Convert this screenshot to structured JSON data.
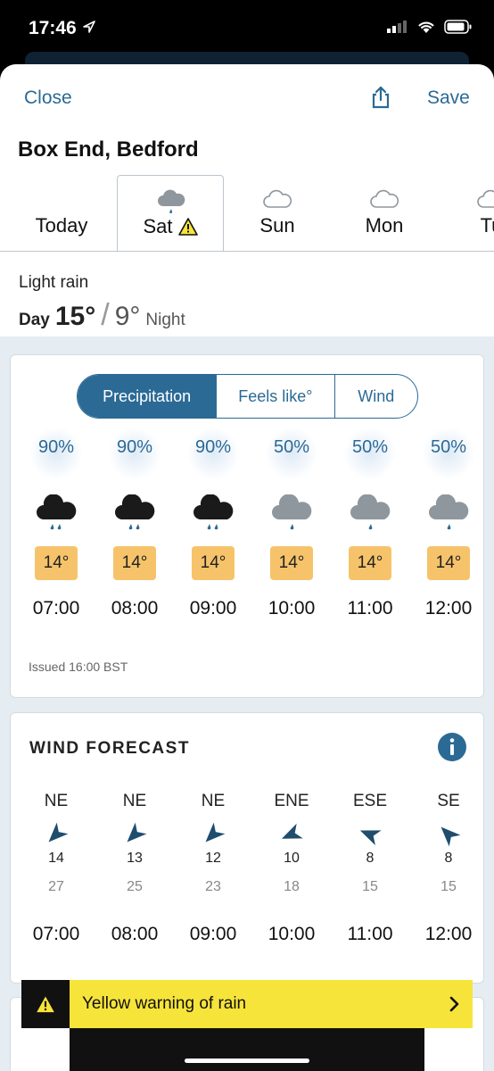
{
  "status": {
    "time": "17:46"
  },
  "header": {
    "close_label": "Close",
    "save_label": "Save",
    "location": "Box End, Bedford"
  },
  "tabs": [
    {
      "label": "Today",
      "icon": "none",
      "active": false
    },
    {
      "label": "Sat",
      "icon": "rain-cloud-icon",
      "warning": true,
      "active": true
    },
    {
      "label": "Sun",
      "icon": "cloud-icon",
      "active": false
    },
    {
      "label": "Mon",
      "icon": "cloud-icon",
      "active": false
    },
    {
      "label": "Tu",
      "icon": "cloud-icon",
      "active": false
    }
  ],
  "summary": {
    "condition": "Light rain",
    "day_label": "Day",
    "day_temp": "15°",
    "night_temp": "9°",
    "night_label": "Night"
  },
  "hourly": {
    "segments": [
      {
        "label": "Precipitation",
        "active": true
      },
      {
        "label": "Feels like°",
        "active": false
      },
      {
        "label": "Wind",
        "active": false
      }
    ],
    "hours": [
      {
        "pct": "90%",
        "icon": "heavy-rain-cloud-icon",
        "temp": "14°",
        "time": "07:00"
      },
      {
        "pct": "90%",
        "icon": "heavy-rain-cloud-icon",
        "temp": "14°",
        "time": "08:00"
      },
      {
        "pct": "90%",
        "icon": "heavy-rain-cloud-icon",
        "temp": "14°",
        "time": "09:00"
      },
      {
        "pct": "50%",
        "icon": "light-rain-cloud-icon",
        "temp": "14°",
        "time": "10:00"
      },
      {
        "pct": "50%",
        "icon": "light-rain-cloud-icon",
        "temp": "14°",
        "time": "11:00"
      },
      {
        "pct": "50%",
        "icon": "light-rain-cloud-icon",
        "temp": "14°",
        "time": "12:00"
      }
    ],
    "issued": "Issued 16:00 BST"
  },
  "wind": {
    "title": "WIND FORECAST",
    "cols": [
      {
        "dir": "NE",
        "speed": "14",
        "gust": "27",
        "time": "07:00"
      },
      {
        "dir": "NE",
        "speed": "13",
        "gust": "25",
        "time": "08:00"
      },
      {
        "dir": "NE",
        "speed": "12",
        "gust": "23",
        "time": "09:00"
      },
      {
        "dir": "ENE",
        "speed": "10",
        "gust": "18",
        "time": "10:00"
      },
      {
        "dir": "ESE",
        "speed": "8",
        "gust": "15",
        "time": "11:00"
      },
      {
        "dir": "SE",
        "speed": "8",
        "gust": "15",
        "time": "12:00"
      }
    ]
  },
  "warning": {
    "text": "Yellow warning of rain"
  },
  "colors": {
    "accent": "#2b6a95",
    "temp_badge": "#f6c36b",
    "warning": "#f7e43a"
  }
}
